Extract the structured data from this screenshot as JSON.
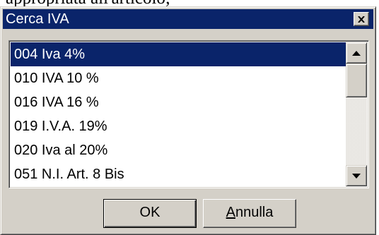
{
  "document": {
    "visible_text": "appropriata all'articolo;"
  },
  "dialog": {
    "title": "Cerca IVA",
    "close_glyph": "×",
    "list": {
      "items": [
        {
          "label": "004 Iva 4%",
          "selected": true
        },
        {
          "label": "010 IVA 10 %",
          "selected": false
        },
        {
          "label": "016 IVA 16 %",
          "selected": false
        },
        {
          "label": "019 I.V.A. 19%",
          "selected": false
        },
        {
          "label": "020 Iva al 20%",
          "selected": false
        },
        {
          "label": "051 N.I. Art. 8 Bis",
          "selected": false
        }
      ]
    },
    "buttons": {
      "ok_label": "OK",
      "cancel_mnemonic": "A",
      "cancel_rest": "nnulla"
    },
    "colors": {
      "titlebar": "#0a246a",
      "selection": "#0a246a",
      "face": "#d4d0c8"
    }
  }
}
